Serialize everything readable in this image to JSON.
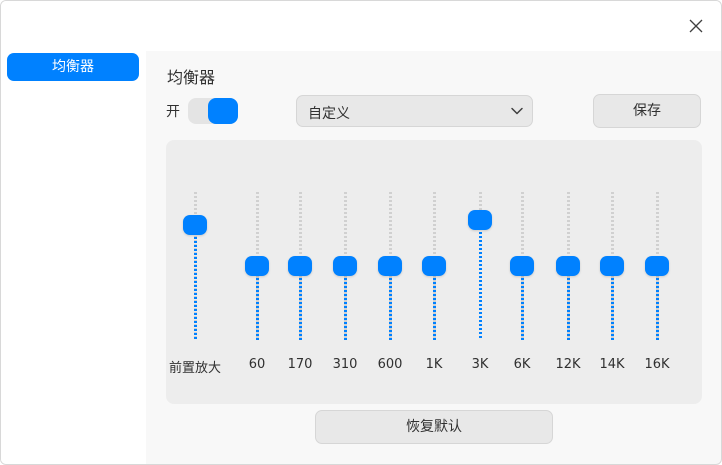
{
  "titlebar": {
    "close_icon": "close-icon"
  },
  "sidebar": {
    "items": [
      {
        "label": "均衡器",
        "selected": true
      }
    ]
  },
  "main": {
    "title": "均衡器",
    "switch": {
      "label": "开",
      "on": true
    },
    "preset": {
      "value": "自定义",
      "icon": "chevron-down-icon"
    },
    "save_label": "保存",
    "reset_label": "恢复默认",
    "bands": [
      {
        "label": "前置放大",
        "level": 0.82
      },
      {
        "label": "60",
        "level": 0.5
      },
      {
        "label": "170",
        "level": 0.5
      },
      {
        "label": "310",
        "level": 0.5
      },
      {
        "label": "600",
        "level": 0.5
      },
      {
        "label": "1K",
        "level": 0.5
      },
      {
        "label": "3K",
        "level": 0.86
      },
      {
        "label": "6K",
        "level": 0.5
      },
      {
        "label": "12K",
        "level": 0.5
      },
      {
        "label": "14K",
        "level": 0.5
      },
      {
        "label": "16K",
        "level": 0.5
      }
    ]
  },
  "colors": {
    "accent": "#0081ff",
    "panel": "#ededed",
    "button": "#e8e8e8"
  }
}
